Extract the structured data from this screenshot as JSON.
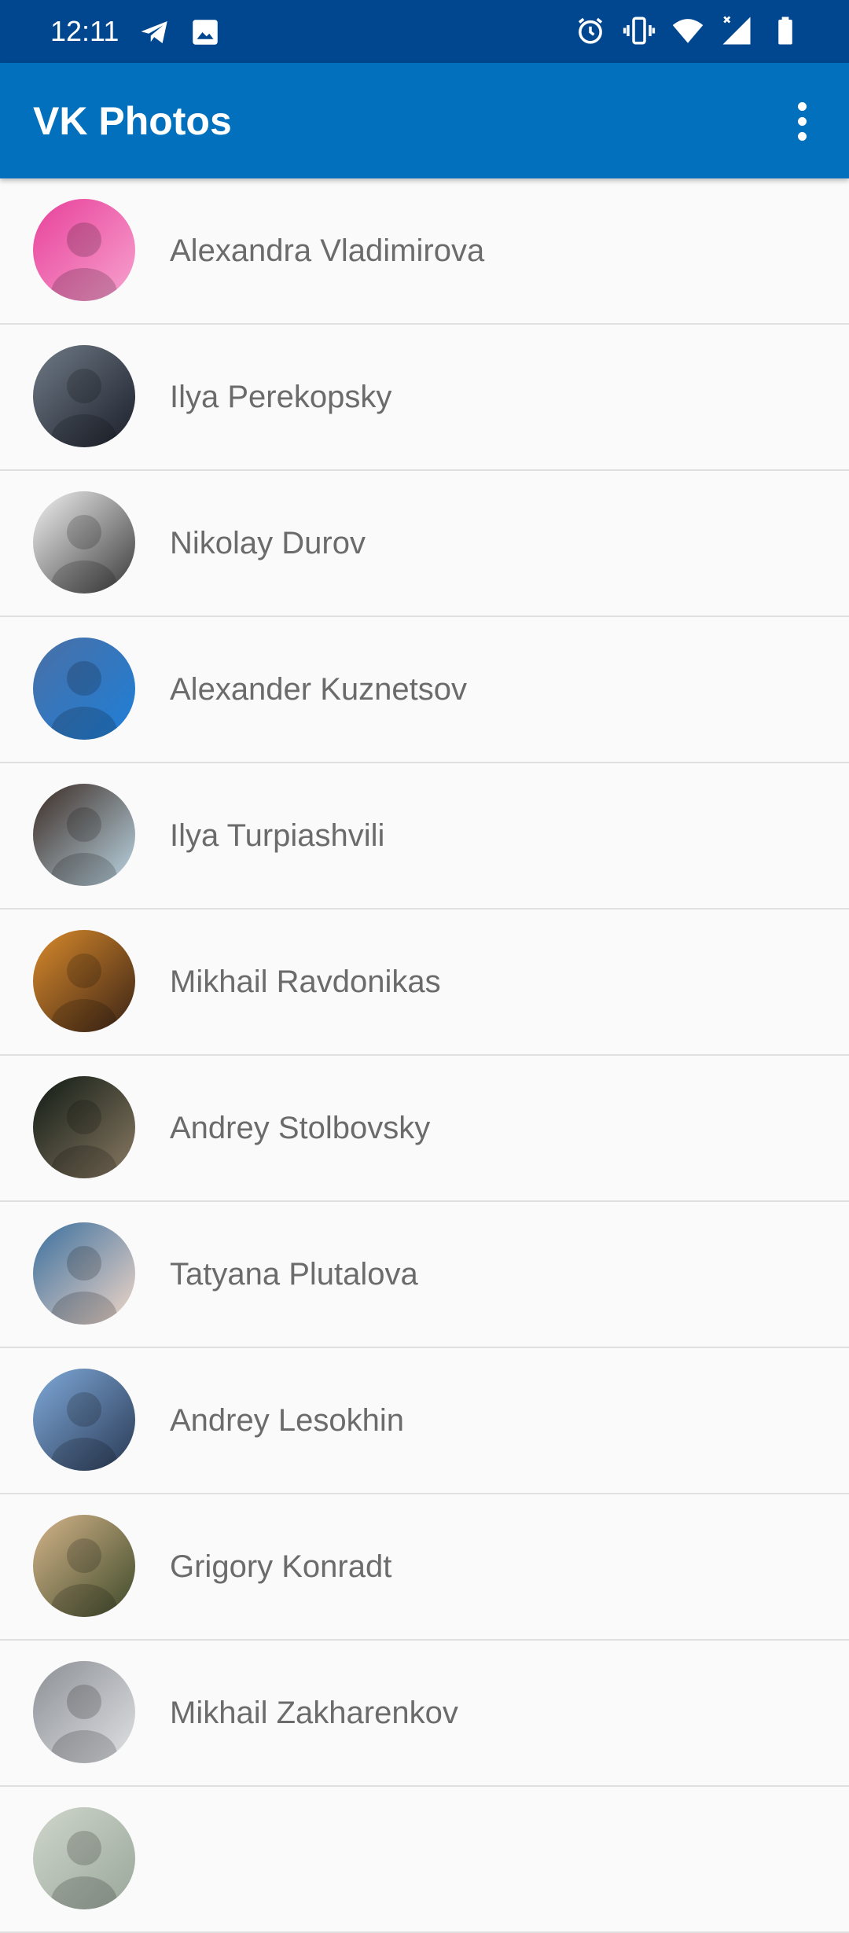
{
  "status_bar": {
    "time": "12:11",
    "left_icons": [
      "telegram-icon",
      "image-icon"
    ],
    "right_icons": [
      "alarm-icon",
      "vibrate-icon",
      "wifi-icon",
      "signal-icon",
      "battery-icon"
    ]
  },
  "app_bar": {
    "title": "VK Photos",
    "menu_icon": "more-vert-icon"
  },
  "contacts": [
    {
      "name": "Alexandra Vladimirova",
      "avatar_colors": [
        "#e8409a",
        "#f7a3cf"
      ]
    },
    {
      "name": "Ilya Perekopsky",
      "avatar_colors": [
        "#6f7a86",
        "#1b1f2a"
      ]
    },
    {
      "name": "Nikolay Durov",
      "avatar_colors": [
        "#f2f2f2",
        "#3a3a3a"
      ]
    },
    {
      "name": "Alexander Kuznetsov",
      "avatar_colors": [
        "#4a6fa5",
        "#1e7fd8"
      ]
    },
    {
      "name": "Ilya Turpiashvili",
      "avatar_colors": [
        "#3a2a22",
        "#bcd6e4"
      ]
    },
    {
      "name": "Mikhail Ravdonikas",
      "avatar_colors": [
        "#d98a2b",
        "#3b2416"
      ]
    },
    {
      "name": "Andrey Stolbovsky",
      "avatar_colors": [
        "#0f1a14",
        "#8a7a63"
      ]
    },
    {
      "name": "Tatyana Plutalova",
      "avatar_colors": [
        "#3a6f9e",
        "#f1d7c8"
      ]
    },
    {
      "name": "Andrey Lesokhin",
      "avatar_colors": [
        "#7fa9d9",
        "#2a3a55"
      ]
    },
    {
      "name": "Grigory Konradt",
      "avatar_colors": [
        "#d4b48a",
        "#3e4a2a"
      ]
    },
    {
      "name": "Mikhail Zakharenkov",
      "avatar_colors": [
        "#8c8f94",
        "#e0e2e5"
      ]
    },
    {
      "name": "",
      "avatar_colors": [
        "#cfd6cc",
        "#9aa79a"
      ]
    }
  ]
}
